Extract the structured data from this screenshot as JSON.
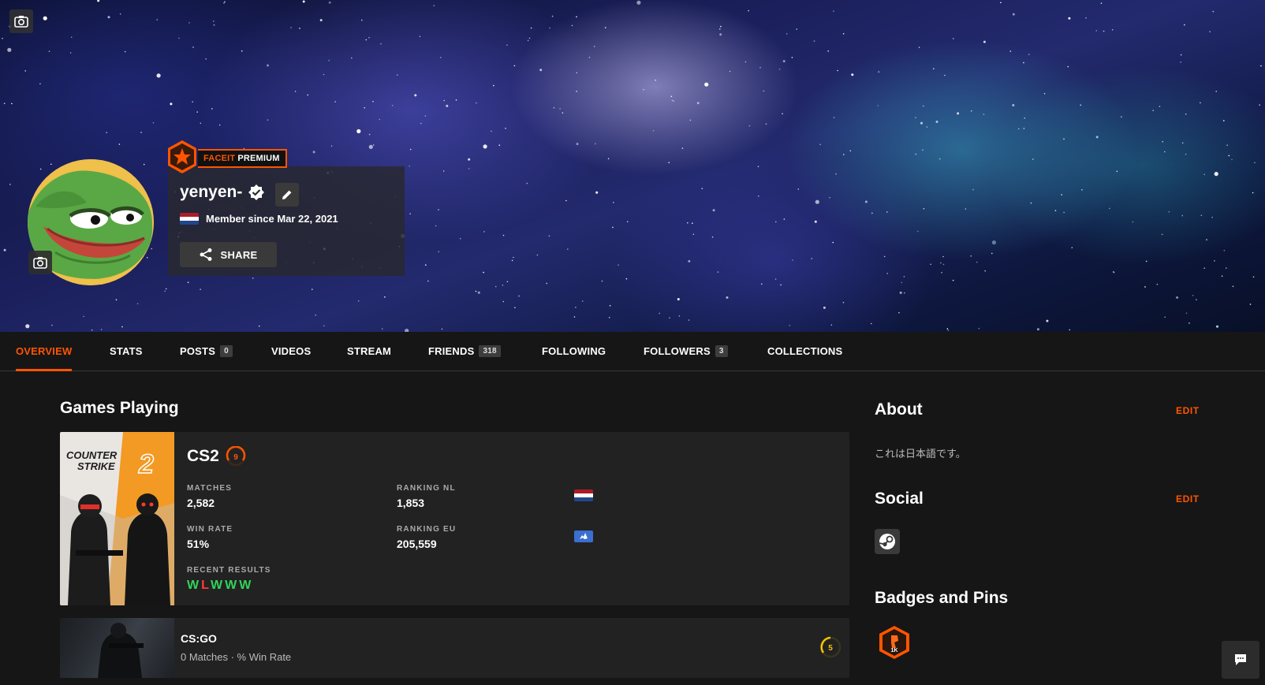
{
  "profile": {
    "username": "yenyen-",
    "member_since": "Member since Mar 22, 2021",
    "share_label": "SHARE",
    "premium_brand": "FACEIT",
    "premium_label": "PREMIUM"
  },
  "tabs": [
    {
      "label": "OVERVIEW",
      "active": true
    },
    {
      "label": "STATS"
    },
    {
      "label": "POSTS",
      "count": "0"
    },
    {
      "label": "VIDEOS"
    },
    {
      "label": "STREAM"
    },
    {
      "label": "FRIENDS",
      "count": "318"
    },
    {
      "label": "FOLLOWING"
    },
    {
      "label": "FOLLOWERS",
      "count": "3"
    },
    {
      "label": "COLLECTIONS"
    }
  ],
  "games_section": {
    "title": "Games Playing",
    "cs2": {
      "name": "CS2",
      "level": "9",
      "art_text": "COUNTER STRIKE",
      "art_number": "2",
      "matches_label": "MATCHES",
      "matches": "2,582",
      "win_rate_label": "WIN RATE",
      "win_rate": "51%",
      "ranking_nl_label": "RANKING NL",
      "ranking_nl": "1,853",
      "ranking_eu_label": "RANKING EU",
      "ranking_eu": "205,559",
      "recent_results_label": "RECENT RESULTS",
      "recent_results": [
        "W",
        "L",
        "W",
        "W",
        "W"
      ]
    },
    "csgo": {
      "name": "CS:GO",
      "summary": "0 Matches · % Win Rate",
      "level": "5"
    }
  },
  "sidebar": {
    "about_title": "About",
    "about_edit": "EDIT",
    "about_text": "これは日本語です。",
    "social_title": "Social",
    "social_edit": "EDIT",
    "badges_title": "Badges and Pins",
    "badge_pin_label": "1K"
  },
  "colors": {
    "accent": "#ff5500",
    "win": "#32d35a",
    "loss": "#ff3b3b",
    "background": "#161616",
    "card": "#222222"
  },
  "icons": [
    "camera-icon",
    "verified-icon",
    "pencil-icon",
    "share-icon",
    "steam-icon",
    "chat-icon",
    "flag-nl-icon",
    "flag-eu-icon",
    "premium-star-icon",
    "level-icon"
  ]
}
